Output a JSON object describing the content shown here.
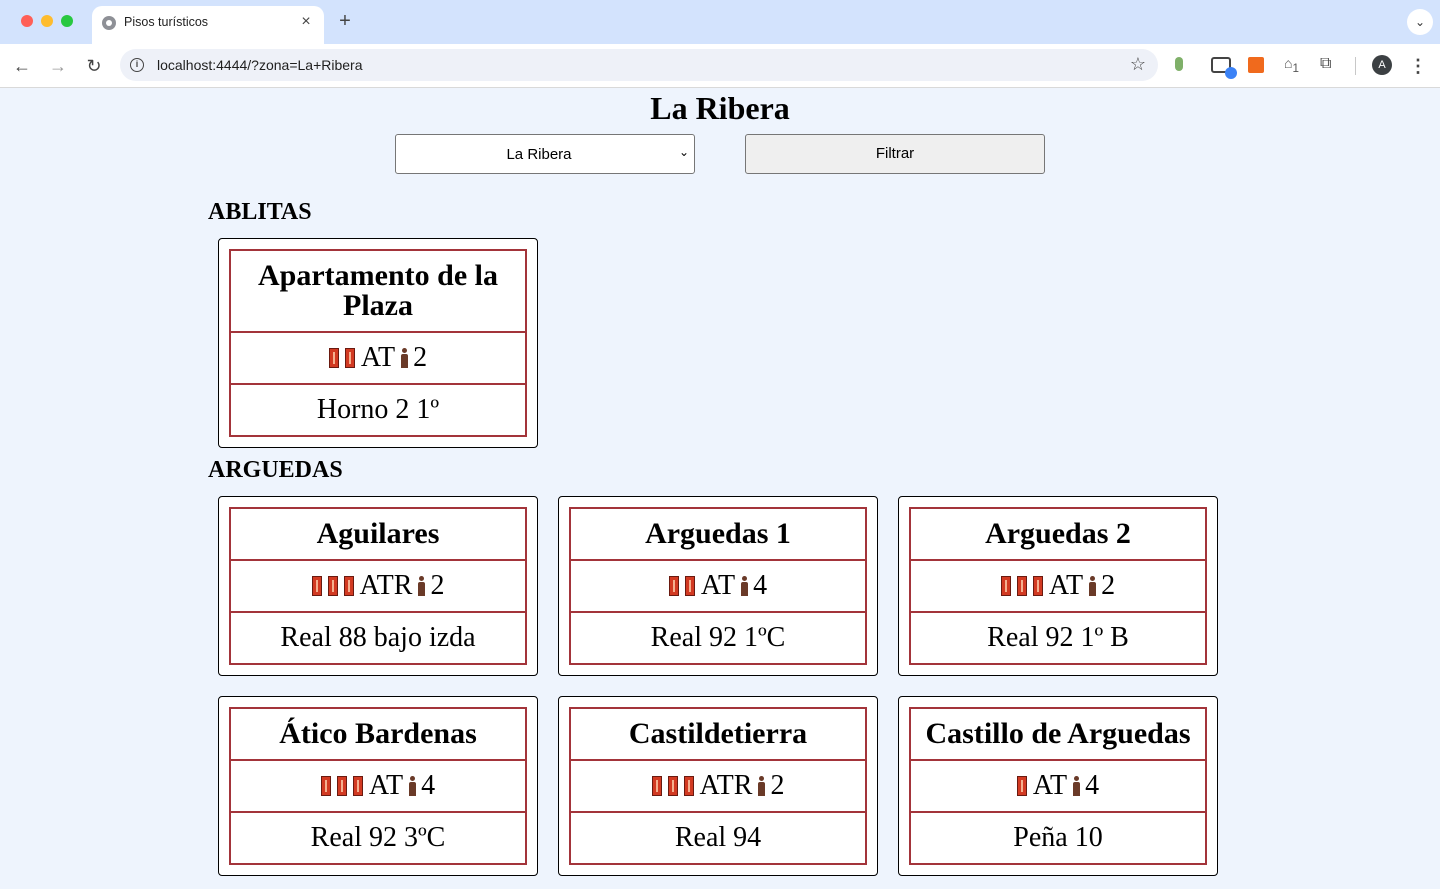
{
  "browser": {
    "tab_title": "Pisos turísticos",
    "tab_close": "×",
    "new_tab": "+",
    "tab_menu": "⌄",
    "url": "localhost:4444/?zona=La+Ribera",
    "avatar_letter": "A",
    "ext4_badge": "1"
  },
  "page": {
    "title": "La Ribera",
    "zone_select": {
      "value": "La Ribera"
    },
    "filter_label": "Filtrar"
  },
  "towns": [
    {
      "name": "ABLITAS",
      "apartments": [
        {
          "name": "Apartamento de la Plaza",
          "keys": 2,
          "category": "AT",
          "capacity": "2",
          "address": "Horno 2 1º"
        }
      ]
    },
    {
      "name": "ARGUEDAS",
      "apartments": [
        {
          "name": "Aguilares",
          "keys": 3,
          "category": "ATR",
          "capacity": "2",
          "address": "Real 88 bajo izda"
        },
        {
          "name": "Arguedas 1",
          "keys": 2,
          "category": "AT",
          "capacity": "4",
          "address": "Real 92 1ºC"
        },
        {
          "name": "Arguedas 2",
          "keys": 3,
          "category": "AT",
          "capacity": "2",
          "address": "Real 92 1º B"
        },
        {
          "name": "Ático Bardenas",
          "keys": 3,
          "category": "AT",
          "capacity": "4",
          "address": "Real 92 3ºC"
        },
        {
          "name": "Castildetierra",
          "keys": 3,
          "category": "ATR",
          "capacity": "2",
          "address": "Real 94"
        },
        {
          "name": "Castillo de Arguedas",
          "keys": 1,
          "category": "AT",
          "capacity": "4",
          "address": "Peña 10"
        }
      ]
    }
  ],
  "icons": {
    "key": "key-icon",
    "person": "person-icon"
  },
  "colors": {
    "page_background": "#eef4fd",
    "card_table_border": "#a3343a",
    "key_icon": "#d23a22",
    "person_icon": "#6a3a28"
  }
}
